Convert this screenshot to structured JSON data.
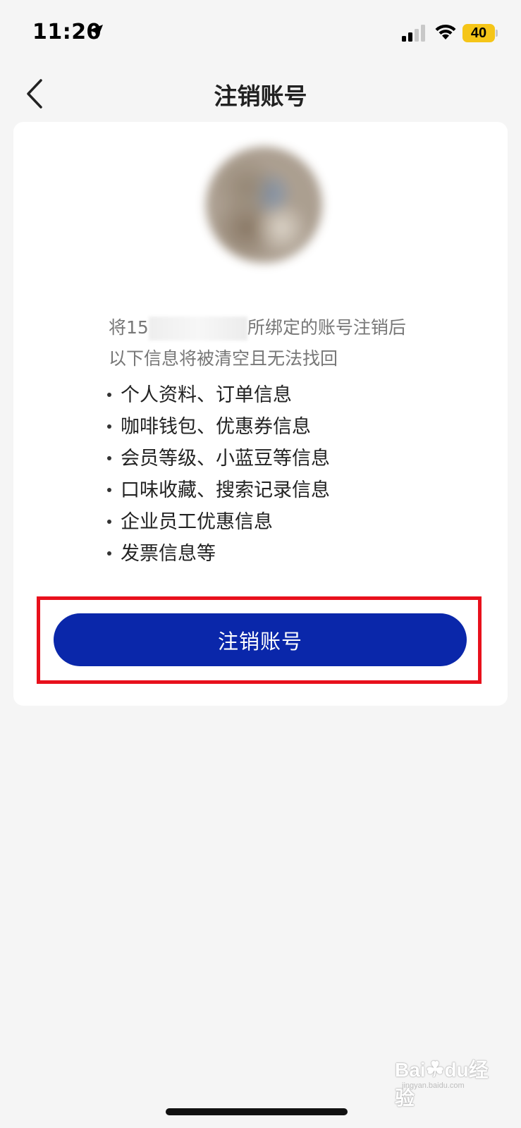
{
  "status_bar": {
    "time": "11:20",
    "battery_level": "40",
    "icons": [
      "location-arrow-icon",
      "cellular-signal-icon",
      "wifi-icon",
      "battery-icon"
    ]
  },
  "nav": {
    "title": "注销账号",
    "back_icon": "chevron-left-icon"
  },
  "notice": {
    "line1_prefix": "将15",
    "line1_suffix": "所绑定的账号注销后",
    "line2": "以下信息将被清空且无法找回"
  },
  "info_items": [
    "个人资料、订单信息",
    "咖啡钱包、优惠券信息",
    "会员等级、小蓝豆等信息",
    "口味收藏、搜索记录信息",
    "企业员工优惠信息",
    "发票信息等"
  ],
  "action": {
    "cancel_button_label": "注销账号"
  },
  "watermark": {
    "brand": "Bai",
    "brand_suffix": "du",
    "cn": "经验",
    "sub": "jingyan.baidu.com"
  },
  "colors": {
    "primary_button": "#0a27aa",
    "highlight_border": "#e8101c",
    "battery": "#f5c518",
    "background": "#f5f5f5"
  }
}
